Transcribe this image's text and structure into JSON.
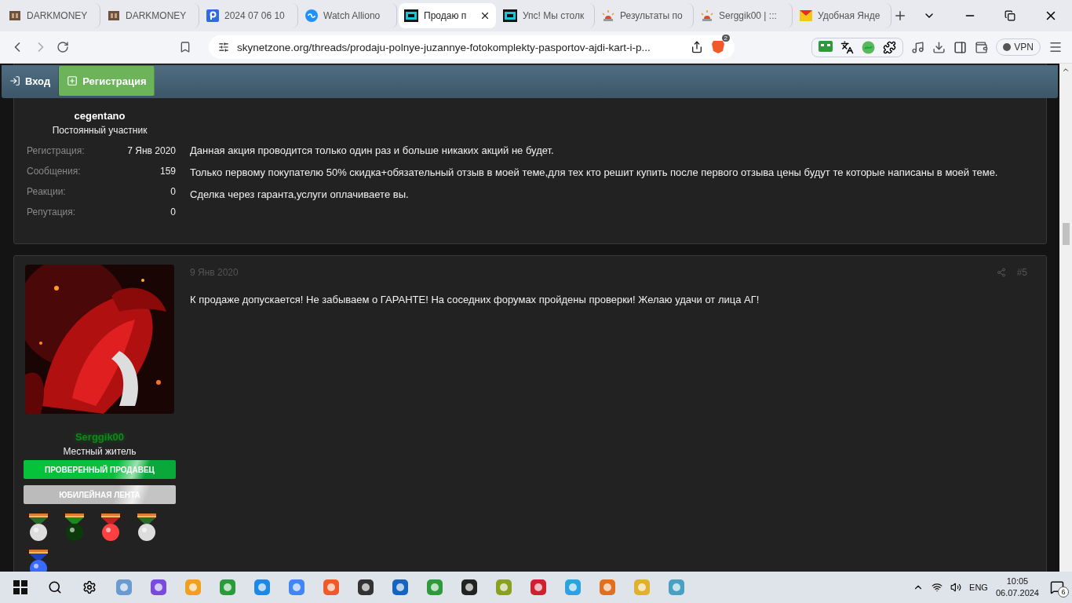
{
  "browser": {
    "tabs": [
      {
        "title": "DARKMONEY",
        "selected": false
      },
      {
        "title": "DARKMONEY",
        "selected": false
      },
      {
        "title": "2024 07 06 10",
        "selected": false
      },
      {
        "title": "Watch Alliono",
        "selected": false
      },
      {
        "title": "Продаю п",
        "selected": true
      },
      {
        "title": "Упс! Мы столк",
        "selected": false
      },
      {
        "title": "Результаты по",
        "selected": false
      },
      {
        "title": "Serggik00 | :::",
        "selected": false
      },
      {
        "title": "Удобная Янде",
        "selected": false
      }
    ],
    "address": "skynetzone.org/threads/prodaju-polnye-juzannye-fotokomplekty-pasportov-ajdi-kart-i-p...",
    "shields_count": "2",
    "vpn": "VPN"
  },
  "header": {
    "buttons": [
      {
        "label": "Вход",
        "kind": "login"
      },
      {
        "label": "Регистрация",
        "kind": "register"
      }
    ]
  },
  "posts": [
    {
      "user": {
        "name": "cegentano",
        "color": "#ffffff",
        "title": "Постоянный участник"
      },
      "stats": [
        {
          "label": "Регистрация:",
          "value": "7 Янв 2020"
        },
        {
          "label": "Сообщения:",
          "value": "159"
        },
        {
          "label": "Реакции:",
          "value": "0"
        },
        {
          "label": "Репутация:",
          "value": "0"
        }
      ],
      "paragraphs": [
        "Данная акция проводится только один раз и больше никаких акций не будет.",
        "Только первому покупателю 50% скидка+обязательный отзыв в моей теме,для тех кто решит купить после первого отзыва цены будут те которые написаны в моей теме.",
        "Сделка через гаранта,услуги оплачиваете вы."
      ]
    },
    {
      "avatar": {
        "kind": "picture"
      },
      "user": {
        "name": "Serggik00",
        "color": "#0d8a1a",
        "title": "Местный житель"
      },
      "banners": [
        {
          "label": "ПРОВЕРЕННЫЙ ПРОДАВЕЦ",
          "kind": "verified"
        },
        {
          "label": "ЮБИЛЕЙНАЯ ЛЕНТА",
          "kind": "jubilee"
        }
      ],
      "date": "9 Янв 2020",
      "number": "#5",
      "paragraphs": [
        "К продаже допускается! Не забываем о ГАРАНТЕ! На соседних форумах пройдены проверки! Желаю удачи от лица АГ!"
      ]
    }
  ],
  "taskbar": {
    "language": "ENG",
    "time": "10:05",
    "date": "06.07.2024",
    "notifications": "6"
  }
}
